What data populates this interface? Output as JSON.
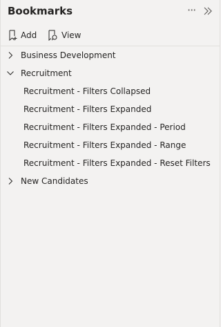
{
  "panel": {
    "title": "Bookmarks",
    "more_icon": "more-horizontal-icon",
    "collapse_icon": "double-chevron-right-icon"
  },
  "toolbar": {
    "add_label": "Add",
    "view_label": "View"
  },
  "bookmarks": {
    "groups": [
      {
        "label": "Business Development",
        "expanded": false,
        "children": []
      },
      {
        "label": "Recruitment",
        "expanded": true,
        "children": [
          "Recruitment - Filters Collapsed",
          "Recruitment - Filters Expanded",
          "Recruitment - Filters Expanded - Period",
          "Recruitment - Filters Expanded - Range",
          "Recruitment - Filters Expanded - Reset Filters"
        ]
      },
      {
        "label": "New Candidates",
        "expanded": false,
        "children": []
      }
    ]
  }
}
